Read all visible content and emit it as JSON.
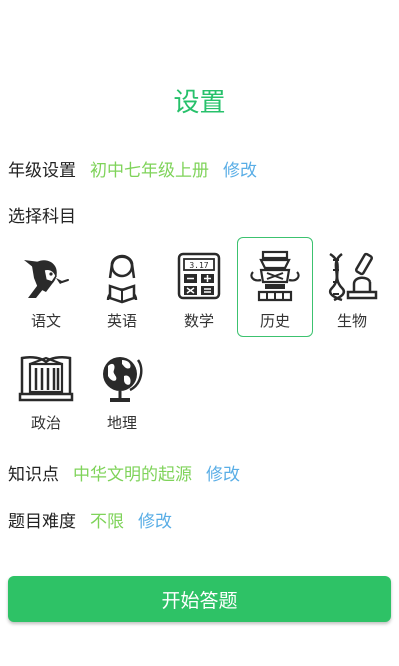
{
  "header": {
    "title": "设置"
  },
  "grade": {
    "label": "年级设置",
    "value": "初中七年级上册",
    "edit": "修改"
  },
  "subjects": {
    "label": "选择科目",
    "items": [
      {
        "name": "语文",
        "icon": "poet-portrait-icon"
      },
      {
        "name": "英语",
        "icon": "reading-girl-icon"
      },
      {
        "name": "数学",
        "icon": "calculator-icon"
      },
      {
        "name": "历史",
        "icon": "ancient-vessel-icon",
        "selected": true
      },
      {
        "name": "生物",
        "icon": "dna-microscope-icon"
      },
      {
        "name": "政治",
        "icon": "book-building-icon"
      },
      {
        "name": "地理",
        "icon": "globe-icon"
      }
    ],
    "calculator_display": "3.17"
  },
  "knowledge": {
    "label": "知识点",
    "value": "中华文明的起源",
    "edit": "修改"
  },
  "difficulty": {
    "label": "题目难度",
    "value": "不限",
    "edit": "修改"
  },
  "start_button": "开始答题",
  "colors": {
    "accent": "#27c16b",
    "value": "#7fd35a",
    "edit": "#5aaee6",
    "button": "#2ec266"
  }
}
